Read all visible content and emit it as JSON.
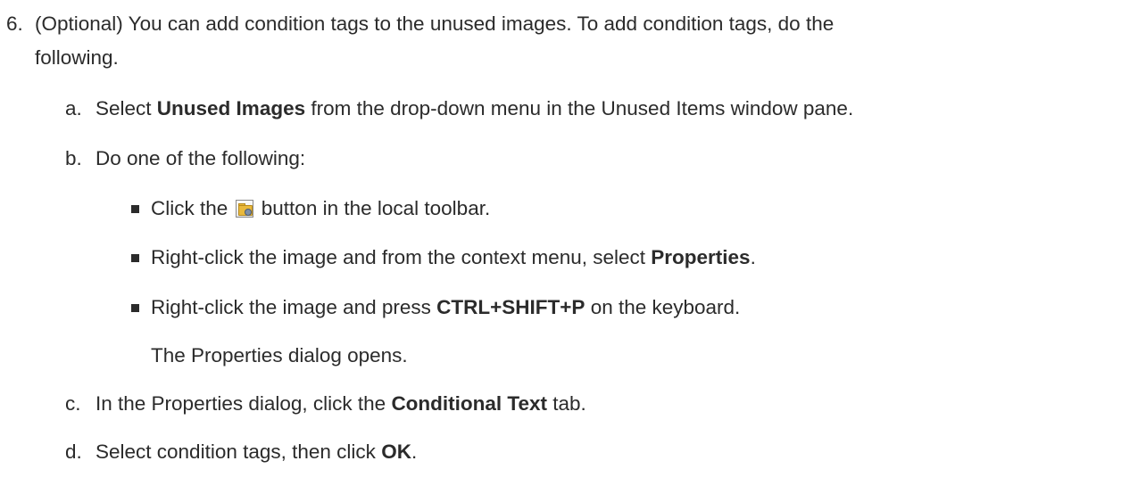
{
  "step": {
    "number": "6.",
    "text_line1": "(Optional) You can add condition tags to the unused images. To add condition tags, do the",
    "text_line2": "following."
  },
  "substeps": {
    "a": {
      "marker": "a.",
      "pre": "Select ",
      "bold": "Unused Images",
      "post": " from the drop-down menu in the Unused Items window pane."
    },
    "b": {
      "marker": "b.",
      "text": "Do one of the following:",
      "bullets": [
        {
          "pre": "Click the ",
          "icon": "folder-gear-icon",
          "post": " button in the local toolbar."
        },
        {
          "pre": "Right-click the image and from the context menu, select ",
          "bold": "Properties",
          "post": "."
        },
        {
          "pre": "Right-click the image and press ",
          "bold": "CTRL+SHIFT+P",
          "post": " on the keyboard."
        }
      ],
      "result": "The Properties dialog opens."
    },
    "c": {
      "marker": "c.",
      "pre": "In the Properties dialog, click the ",
      "bold": "Conditional Text",
      "post": " tab."
    },
    "d": {
      "marker": "d.",
      "pre": "Select condition tags, then click ",
      "bold": "OK",
      "post": "."
    }
  }
}
